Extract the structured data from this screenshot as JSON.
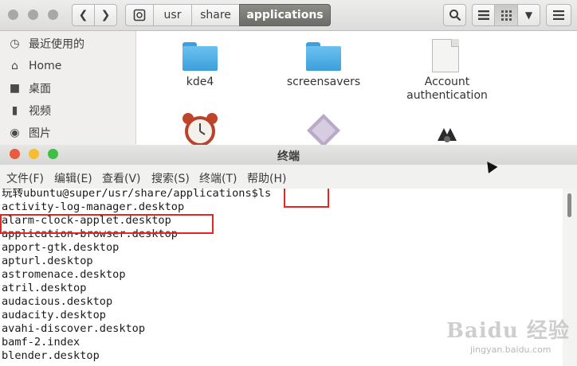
{
  "file_manager": {
    "breadcrumbs": [
      "usr",
      "share",
      "applications"
    ],
    "sidebar": [
      {
        "label": "最近使用的",
        "icon": "clock-icon"
      },
      {
        "label": "Home",
        "icon": "home-icon"
      },
      {
        "label": "桌面",
        "icon": "folder-icon"
      },
      {
        "label": "视频",
        "icon": "video-icon"
      },
      {
        "label": "图片",
        "icon": "camera-icon"
      }
    ],
    "items": [
      {
        "label": "kde4",
        "icon": "folder-icon"
      },
      {
        "label": "screensavers",
        "icon": "folder-icon"
      },
      {
        "label_line1": "Account",
        "label_line2": "authentication",
        "icon": "document-icon"
      }
    ]
  },
  "terminal": {
    "title": "终端",
    "menu": [
      "文件(F)",
      "编辑(E)",
      "查看(V)",
      "搜索(S)",
      "终端(T)",
      "帮助(H)"
    ],
    "lines": [
      "玩转ubuntu@super/usr/share/applications$ls",
      "activity-log-manager.desktop",
      "alarm-clock-applet.desktop",
      "application-browser.desktop",
      "apport-gtk.desktop",
      "apturl.desktop",
      "astromenace.desktop",
      "atril.desktop",
      "audacious.desktop",
      "audacity.desktop",
      "avahi-discover.desktop",
      "bamf-2.index",
      "blender.desktop"
    ]
  },
  "watermark": {
    "logo": "Baidu 经验",
    "url": "jingyan.baidu.com"
  },
  "colors": {
    "highlight_box": "#e32525",
    "breadcrumb_active": "#6c6c69",
    "folder": "#3d9fdb"
  }
}
